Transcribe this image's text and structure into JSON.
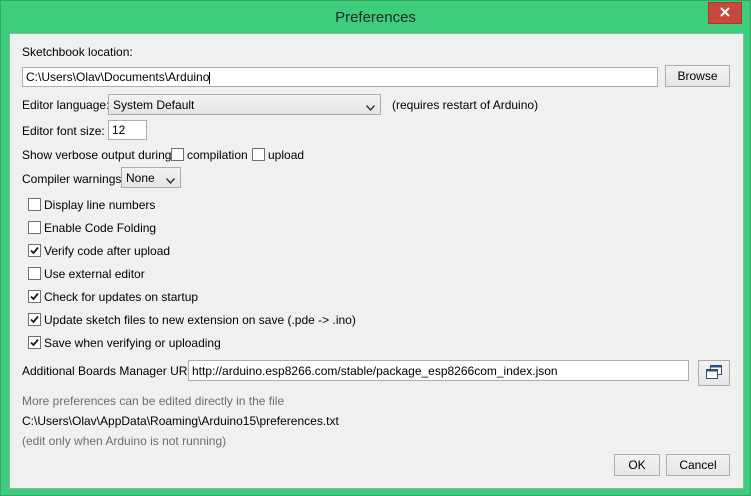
{
  "window": {
    "title": "Preferences"
  },
  "sketchbook": {
    "label": "Sketchbook location:",
    "value": "C:\\Users\\Olav\\Documents\\Arduino",
    "browse_label": "Browse"
  },
  "editor_language": {
    "label": "Editor language:",
    "selected": "System Default",
    "note": "(requires restart of Arduino)"
  },
  "font_size": {
    "label": "Editor font size:",
    "value": "12"
  },
  "verbose": {
    "label": "Show verbose output during:",
    "compilation_label": "compilation",
    "compilation_checked": false,
    "upload_label": "upload",
    "upload_checked": false
  },
  "compiler_warnings": {
    "label": "Compiler warnings:",
    "selected": "None"
  },
  "options": [
    {
      "label": "Display line numbers",
      "checked": false
    },
    {
      "label": "Enable Code Folding",
      "checked": false
    },
    {
      "label": "Verify code after upload",
      "checked": true
    },
    {
      "label": "Use external editor",
      "checked": false
    },
    {
      "label": "Check for updates on startup",
      "checked": true
    },
    {
      "label": "Update sketch files to new extension on save (.pde -> .ino)",
      "checked": true
    },
    {
      "label": "Save when verifying or uploading",
      "checked": true
    }
  ],
  "boards_manager": {
    "label": "Additional Boards Manager URLs:",
    "value": "http://arduino.esp8266.com/stable/package_esp8266com_index.json"
  },
  "footer": {
    "more_prefs": "More preferences can be edited directly in the file",
    "prefs_path": "C:\\Users\\Olav\\AppData\\Roaming\\Arduino15\\preferences.txt",
    "edit_note": "(edit only when Arduino is not running)"
  },
  "buttons": {
    "ok": "OK",
    "cancel": "Cancel"
  }
}
